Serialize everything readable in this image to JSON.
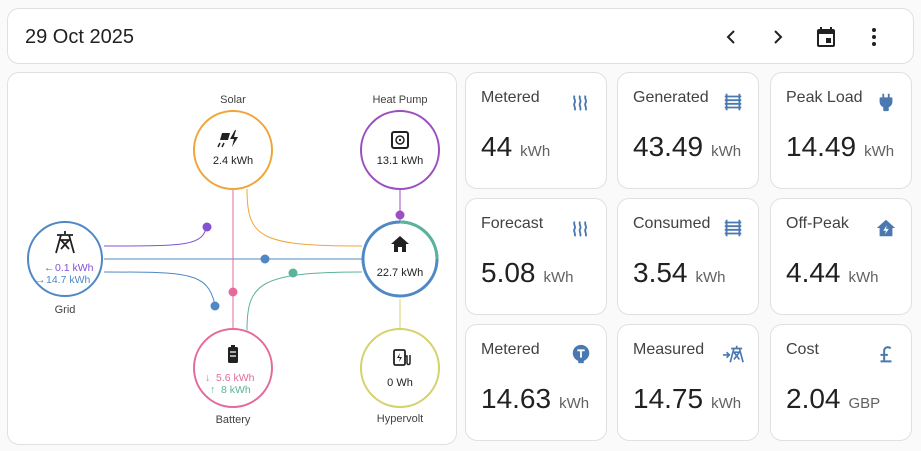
{
  "header": {
    "date": "29 Oct 2025",
    "icons": [
      "chevron-left-icon",
      "chevron-right-icon",
      "calendar-icon",
      "more-vert-icon"
    ]
  },
  "flow": {
    "solar": {
      "label": "Solar",
      "value": "2.4 kWh"
    },
    "heat_pump": {
      "label": "Heat Pump",
      "value": "13.1 kWh"
    },
    "grid": {
      "label": "Grid",
      "out": "0.1 kWh",
      "in": "14.7 kWh"
    },
    "home": {
      "value": "22.7 kWh"
    },
    "battery": {
      "label": "Battery",
      "in": "5.6 kWh",
      "out": "8 kWh"
    },
    "hypervolt": {
      "label": "Hypervolt",
      "value": "0 Wh"
    }
  },
  "stats": [
    {
      "title": "Metered",
      "value": "44",
      "unit": "kWh",
      "icon": "radiator-icon"
    },
    {
      "title": "Generated",
      "value": "43.49",
      "unit": "kWh",
      "icon": "heat-exchanger-icon"
    },
    {
      "title": "Peak Load",
      "value": "14.49",
      "unit": "kWh",
      "icon": "plug-icon"
    },
    {
      "title": "Forecast",
      "value": "5.08",
      "unit": "kWh",
      "icon": "radiator-icon"
    },
    {
      "title": "Consumed",
      "value": "3.54",
      "unit": "kWh",
      "icon": "heat-exchanger-icon"
    },
    {
      "title": "Off-Peak",
      "value": "4.44",
      "unit": "kWh",
      "icon": "home-lightning-icon"
    },
    {
      "title": "Metered",
      "value": "14.63",
      "unit": "kWh",
      "icon": "meter-icon"
    },
    {
      "title": "Measured",
      "value": "14.75",
      "unit": "kWh",
      "icon": "transmission-tower-import-icon"
    },
    {
      "title": "Cost",
      "value": "2.04",
      "unit": "GBP",
      "icon": "currency-gbp-icon"
    }
  ],
  "colors": {
    "solar": "#f0a53a",
    "heat_pump": "#9c4fc0",
    "grid": "#4f88c4",
    "grid_return": "#8353d1",
    "battery": "#e56a9c",
    "battery_out": "#5bb39b",
    "hypervolt": "#d4d26a",
    "icon": "#4a79b0"
  }
}
